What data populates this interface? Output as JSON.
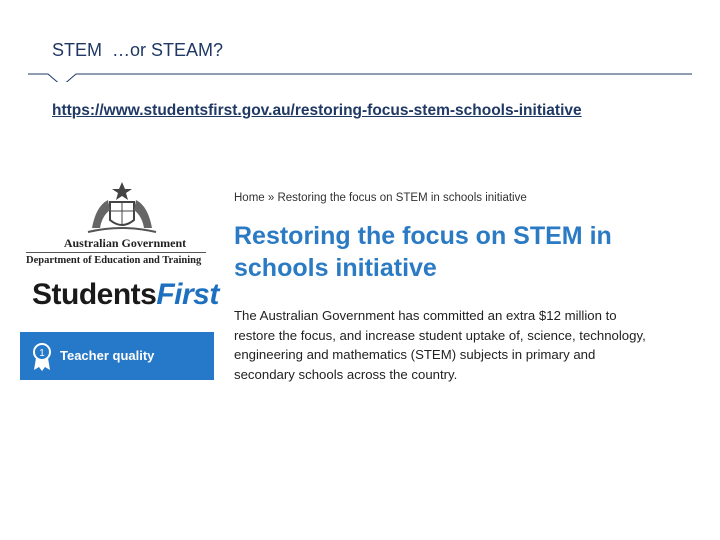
{
  "slide": {
    "title": "STEM  …or STEAM?",
    "url": "https://www.studentsfirst.gov.au/restoring-focus-stem-schools-initiative"
  },
  "screenshot": {
    "header": {
      "gov_name": "Australian Government",
      "dept_name": "Department of Education and Training",
      "logo_part1": "Students",
      "logo_part2": "First"
    },
    "sidebar": {
      "teacher_quality": "Teacher quality"
    },
    "breadcrumb": "Home » Restoring the focus on STEM in schools initiative",
    "heading": "Restoring the focus on STEM in schools initiative",
    "body": "The Australian Government has committed an extra $12 million to restore the focus, and increase student uptake of, science, technology, engineering and mathematics (STEM) subjects in primary and secondary schools across the country."
  },
  "colors": {
    "title": "#1f3864",
    "heading": "#2a7ac4",
    "tile": "#2678c8",
    "logo_accent": "#1d6fc0"
  }
}
